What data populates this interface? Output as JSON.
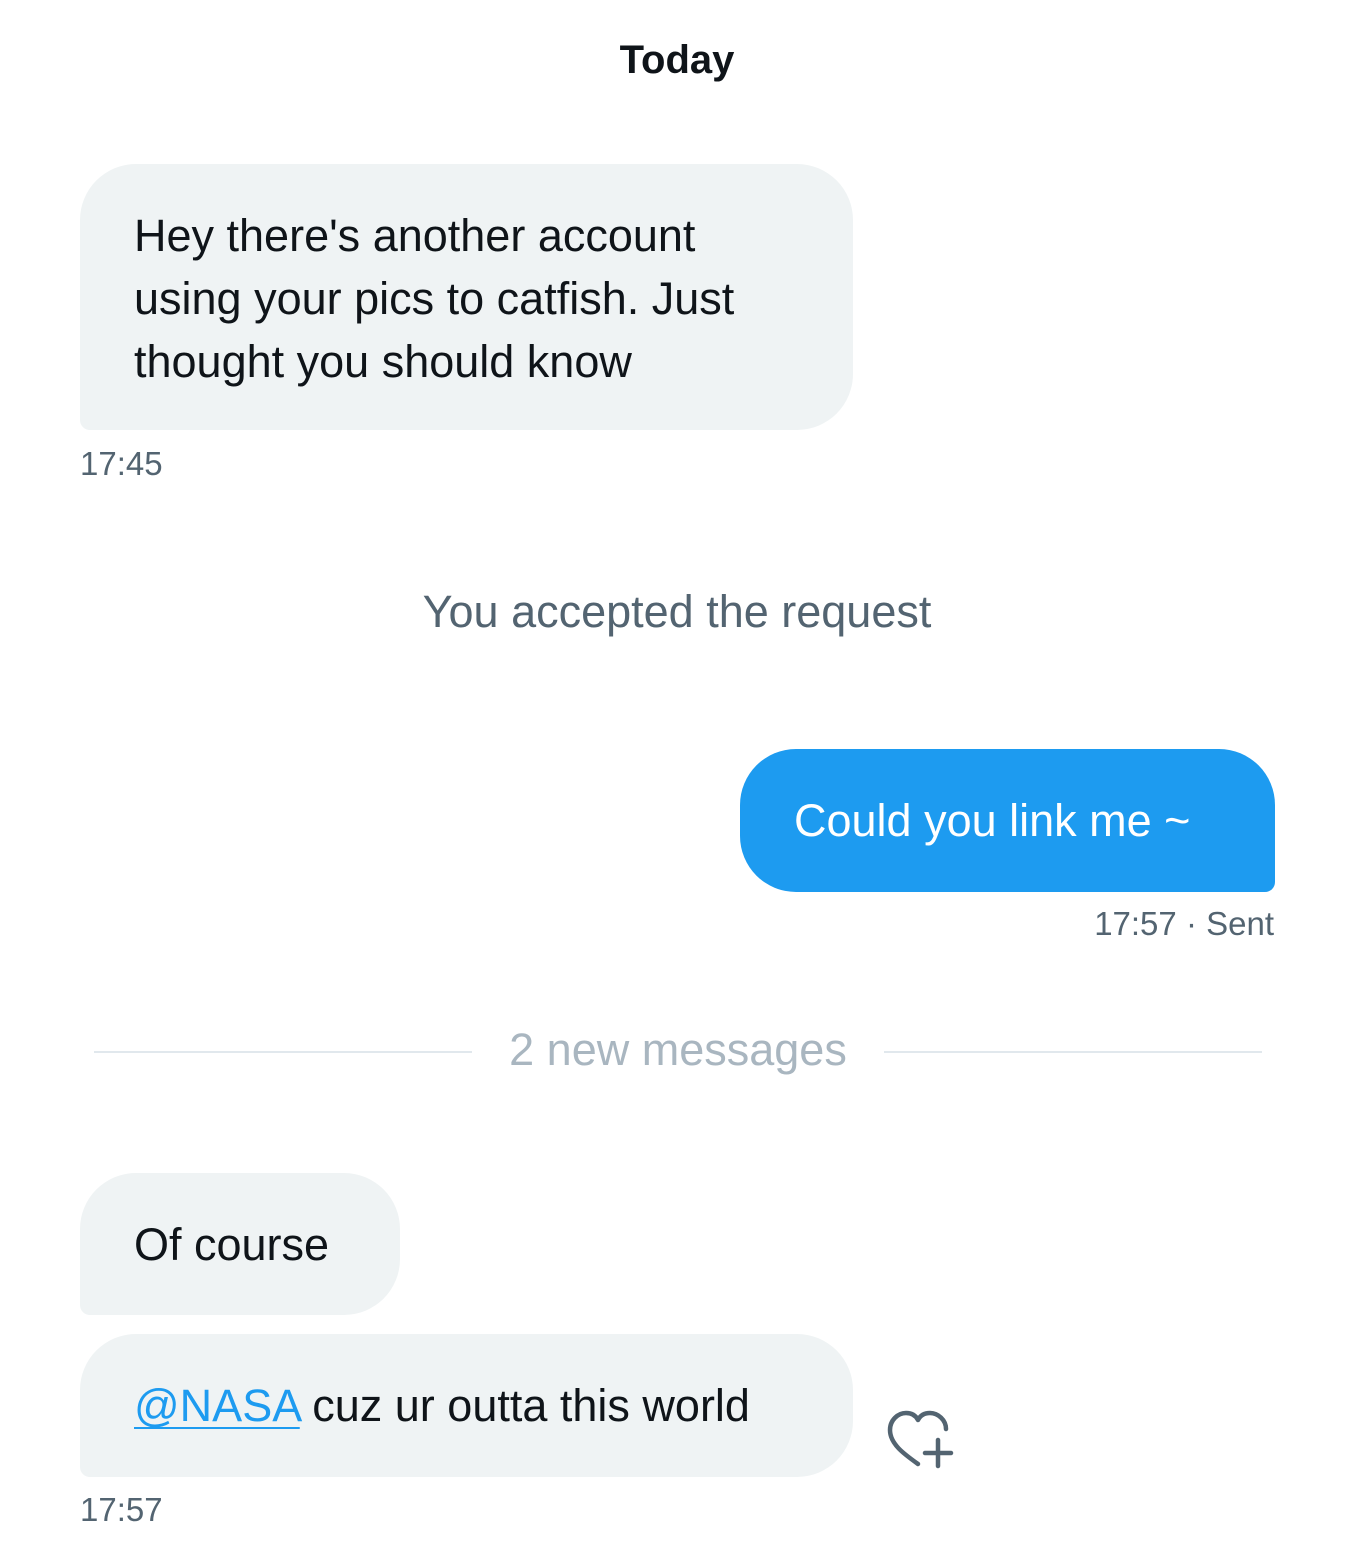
{
  "conversation": {
    "day_label": "Today",
    "messages": [
      {
        "direction": "incoming",
        "text": "Hey there's another account using your pics to catfish. Just thought you should know",
        "time": "17:45"
      },
      {
        "direction": "system",
        "text": "You accepted the request"
      },
      {
        "direction": "outgoing",
        "text": "Could you link me ~",
        "time": "17:57",
        "status": "· Sent"
      },
      {
        "direction": "divider",
        "text": "2 new messages"
      },
      {
        "direction": "incoming",
        "text": "Of course"
      },
      {
        "direction": "incoming",
        "mention": "@NASA",
        "text": " cuz ur outta this world",
        "time": "17:57",
        "reaction_icon": "heart-plus-icon"
      }
    ]
  },
  "colors": {
    "incoming_bubble": "#eff3f4",
    "outgoing_bubble": "#1d9bf0",
    "link": "#1d9bf0",
    "secondary_text": "#536471",
    "divider_text": "#a9b6c0"
  }
}
